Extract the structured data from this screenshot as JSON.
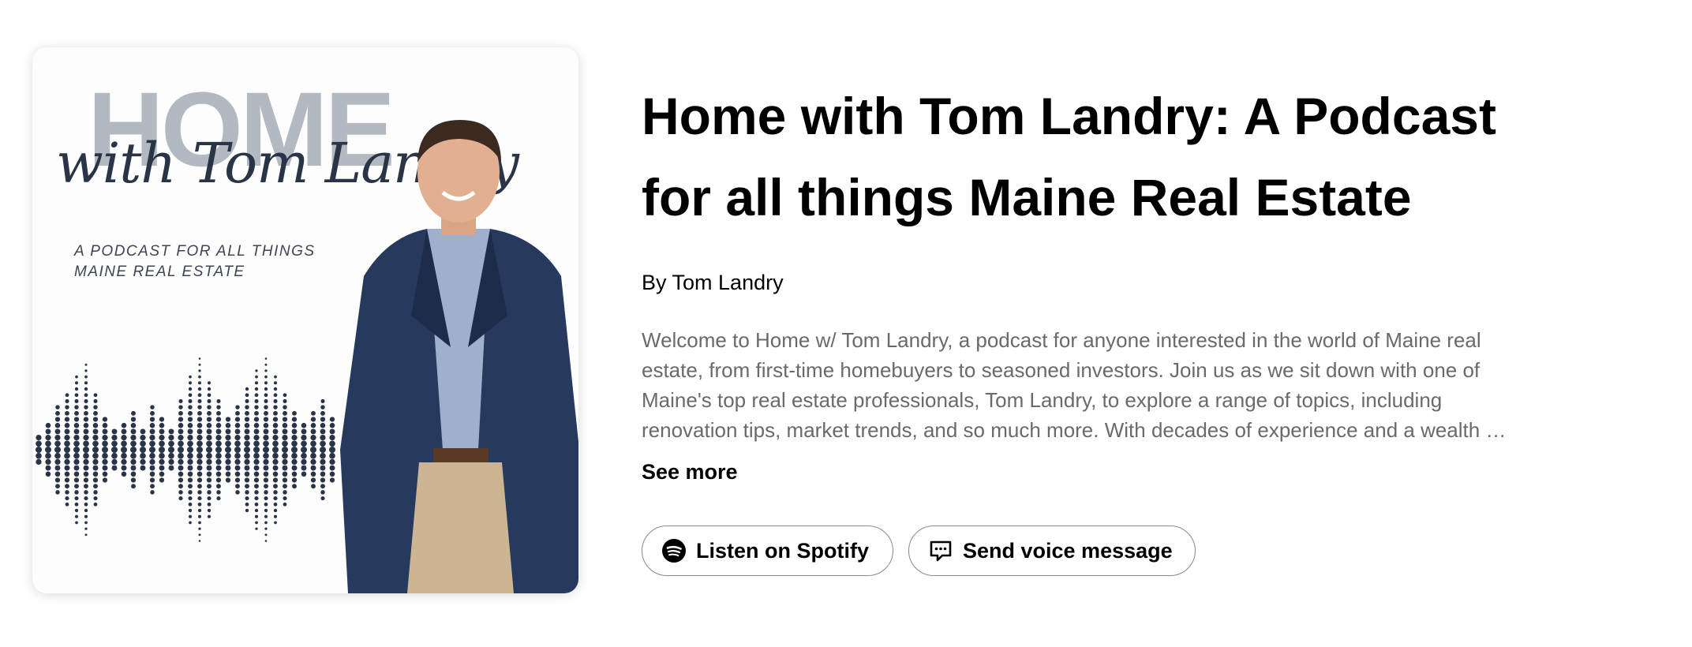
{
  "cover": {
    "home_word": "HOME",
    "script_name": "with Tom Landry",
    "tagline_lines": [
      "A PODCAST FOR ALL THINGS",
      "MAINE REAL ESTATE"
    ]
  },
  "podcast": {
    "title_lines": [
      "Home with Tom Landry: A Podcast",
      "for all things Maine Real Estate"
    ],
    "author": "By Tom Landry",
    "description_lines": [
      "Welcome to Home w/ Tom Landry, a podcast for anyone interested in the world of Maine real",
      "estate, from first-time homebuyers to seasoned investors. Join us as we sit down with one of",
      "Maine's top real estate professionals, Tom Landry, to explore a range of topics, including",
      "renovation tips, market trends, and so much more. With decades of experience and a wealth …"
    ],
    "see_more_label": "See more"
  },
  "actions": {
    "listen_label": "Listen on Spotify",
    "listen_icon": "spotify-icon",
    "voice_label": "Send voice message",
    "voice_icon": "message-bubble-icon"
  },
  "colors": {
    "home_gray": "#b3b9c1",
    "navy": "#2a3447",
    "description_gray": "#6a6a6a",
    "button_border": "#8a8a8a"
  }
}
